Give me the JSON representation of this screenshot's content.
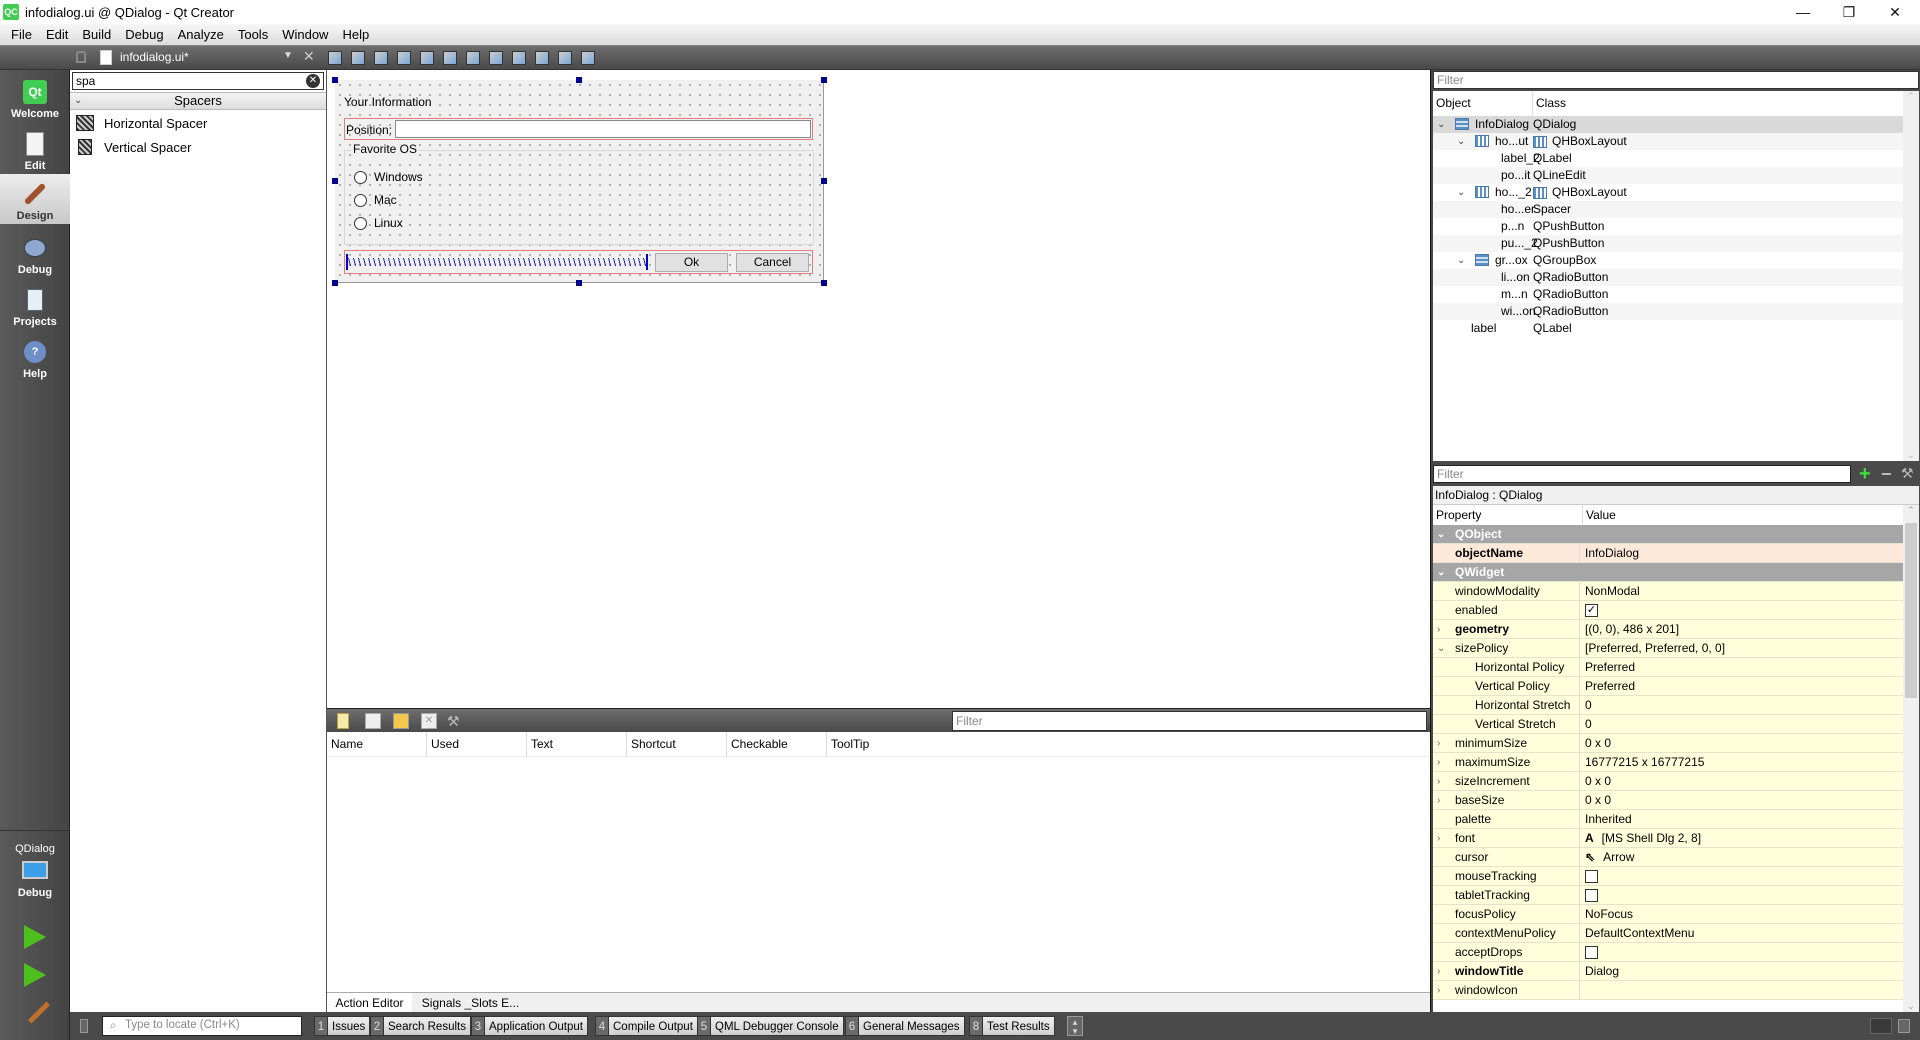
{
  "window": {
    "title": "infodialog.ui @ QDialog - Qt Creator",
    "app_icon": "QC",
    "controls": {
      "minimize": "—",
      "maximize": "❐",
      "close": "✕"
    }
  },
  "menubar": [
    {
      "label": "File",
      "mnemonic": "F"
    },
    {
      "label": "Edit",
      "mnemonic": "E"
    },
    {
      "label": "Build",
      "mnemonic": "B"
    },
    {
      "label": "Debug",
      "mnemonic": "D"
    },
    {
      "label": "Analyze",
      "mnemonic": "A"
    },
    {
      "label": "Tools",
      "mnemonic": "T"
    },
    {
      "label": "Window",
      "mnemonic": "W"
    },
    {
      "label": "Help",
      "mnemonic": "H"
    }
  ],
  "editor_tab": {
    "filename": "infodialog.ui*"
  },
  "form_toolbar_icons": [
    "edit-widgets-icon",
    "edit-signals-slots-icon",
    "edit-buddies-icon",
    "edit-tab-order-icon",
    "layout-horizontal-icon",
    "layout-vertical-icon",
    "layout-horizontal-splitter-icon",
    "layout-vertical-splitter-icon",
    "layout-form-icon",
    "layout-grid-icon",
    "break-layout-icon",
    "adjust-size-icon"
  ],
  "modes": [
    {
      "label": "Welcome",
      "icon": "qt-logo-icon"
    },
    {
      "label": "Edit",
      "icon": "edit-document-icon"
    },
    {
      "label": "Design",
      "icon": "design-brush-icon",
      "active": true
    },
    {
      "label": "Debug",
      "icon": "debug-bug-icon"
    },
    {
      "label": "Projects",
      "icon": "projects-folder-icon"
    },
    {
      "label": "Help",
      "icon": "help-icon"
    }
  ],
  "kit_selector": {
    "project": "QDialog",
    "build": "Debug"
  },
  "widget_box": {
    "search_value": "spa",
    "category": "Spacers",
    "items": [
      "Horizontal Spacer",
      "Vertical Spacer"
    ]
  },
  "form": {
    "title_label": "Your Information",
    "position_label": "Position:",
    "position_value": "",
    "group_title": "Favorite OS",
    "radios": [
      "Windows",
      "Mac",
      "Linux"
    ],
    "ok_label": "Ok",
    "cancel_label": "Cancel"
  },
  "action_editor": {
    "filter_placeholder": "Filter",
    "columns": [
      "Name",
      "Used",
      "Text",
      "Shortcut",
      "Checkable",
      "ToolTip"
    ],
    "tabs": [
      "Action Editor",
      "Signals _Slots E..."
    ],
    "active_tab": 0
  },
  "object_inspector": {
    "filter_placeholder": "Filter",
    "columns": [
      "Object",
      "Class"
    ],
    "rows": [
      {
        "object": "InfoDialog",
        "class": "QDialog",
        "level": 0,
        "expanded": true,
        "icon": "vbox",
        "selected": true
      },
      {
        "object": "ho...ut",
        "class": "QHBoxLayout",
        "level": 1,
        "expanded": true,
        "icon": "hbox"
      },
      {
        "object": "label_2",
        "class": "QLabel",
        "level": 2
      },
      {
        "object": "po...it",
        "class": "QLineEdit",
        "level": 2
      },
      {
        "object": "ho..._2",
        "class": "QHBoxLayout",
        "level": 1,
        "expanded": true,
        "icon": "hbox"
      },
      {
        "object": "ho...er",
        "class": "Spacer",
        "level": 2
      },
      {
        "object": "p...n",
        "class": "QPushButton",
        "level": 2
      },
      {
        "object": "pu..._2",
        "class": "QPushButton",
        "level": 2
      },
      {
        "object": "gr...ox",
        "class": "QGroupBox",
        "level": 1,
        "expanded": true,
        "icon": "vbox"
      },
      {
        "object": "li...on",
        "class": "QRadioButton",
        "level": 2
      },
      {
        "object": "m...n",
        "class": "QRadioButton",
        "level": 2
      },
      {
        "object": "wi...on",
        "class": "QRadioButton",
        "level": 2
      },
      {
        "object": "label",
        "class": "QLabel",
        "level": 1
      }
    ]
  },
  "property_editor": {
    "filter_placeholder": "Filter",
    "context": "InfoDialog : QDialog",
    "columns": [
      "Property",
      "Value"
    ],
    "rows": [
      {
        "type": "group",
        "name": "QObject"
      },
      {
        "type": "prop",
        "name": "objectName",
        "value": "InfoDialog",
        "bold": true,
        "style": "o"
      },
      {
        "type": "group",
        "name": "QWidget"
      },
      {
        "type": "prop",
        "name": "windowModality",
        "value": "NonModal"
      },
      {
        "type": "check",
        "name": "enabled",
        "checked": true
      },
      {
        "type": "prop",
        "name": "geometry",
        "value": "[(0, 0), 486 x 201]",
        "bold": true,
        "expander": "collapsed"
      },
      {
        "type": "prop",
        "name": "sizePolicy",
        "value": "[Preferred, Preferred, 0, 0]",
        "expander": "expanded"
      },
      {
        "type": "sub",
        "name": "Horizontal Policy",
        "value": "Preferred"
      },
      {
        "type": "sub",
        "name": "Vertical Policy",
        "value": "Preferred"
      },
      {
        "type": "sub",
        "name": "Horizontal Stretch",
        "value": "0"
      },
      {
        "type": "sub",
        "name": "Vertical Stretch",
        "value": "0"
      },
      {
        "type": "prop",
        "name": "minimumSize",
        "value": "0 x 0",
        "expander": "collapsed"
      },
      {
        "type": "prop",
        "name": "maximumSize",
        "value": "16777215 x 16777215",
        "expander": "collapsed"
      },
      {
        "type": "prop",
        "name": "sizeIncrement",
        "value": "0 x 0",
        "expander": "collapsed"
      },
      {
        "type": "prop",
        "name": "baseSize",
        "value": "0 x 0",
        "expander": "collapsed"
      },
      {
        "type": "prop",
        "name": "palette",
        "value": "Inherited"
      },
      {
        "type": "prop",
        "name": "font",
        "value": "[MS Shell Dlg 2, 8]",
        "expander": "collapsed",
        "icon": "A"
      },
      {
        "type": "prop",
        "name": "cursor",
        "value": "Arrow",
        "icon": "⇖"
      },
      {
        "type": "check",
        "name": "mouseTracking",
        "checked": false
      },
      {
        "type": "check",
        "name": "tabletTracking",
        "checked": false
      },
      {
        "type": "prop",
        "name": "focusPolicy",
        "value": "NoFocus"
      },
      {
        "type": "prop",
        "name": "contextMenuPolicy",
        "value": "DefaultContextMenu"
      },
      {
        "type": "check",
        "name": "acceptDrops",
        "checked": false
      },
      {
        "type": "prop",
        "name": "windowTitle",
        "value": "Dialog",
        "bold": true,
        "expander": "collapsed"
      },
      {
        "type": "prop",
        "name": "windowIcon",
        "value": "",
        "expander": "collapsed"
      }
    ]
  },
  "statusbar": {
    "locate_placeholder": "Type to locate (Ctrl+K)",
    "panes": [
      {
        "num": "1",
        "label": "Issues"
      },
      {
        "num": "2",
        "label": "Search Results"
      },
      {
        "num": "3",
        "label": "Application Output"
      },
      {
        "num": "4",
        "label": "Compile Output"
      },
      {
        "num": "5",
        "label": "QML Debugger Console"
      },
      {
        "num": "6",
        "label": "General Messages"
      },
      {
        "num": "8",
        "label": "Test Results"
      }
    ]
  },
  "colors": {
    "selection_handle": "#00008b",
    "layout_border": "#e87b7b",
    "property_row": "#ffffdc",
    "property_changed_row": "#fde9d9",
    "property_group": "#a6a6a6",
    "qt_green": "#41cd52"
  }
}
